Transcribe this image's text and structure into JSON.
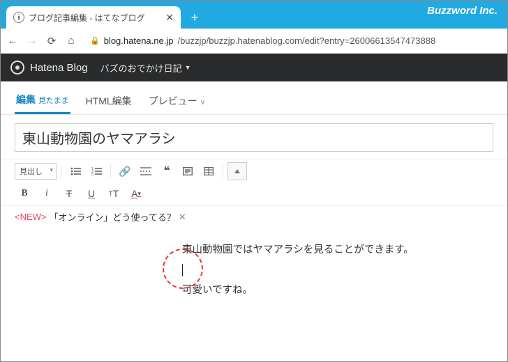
{
  "brand": "Buzzword Inc.",
  "browser_tab": {
    "title": "ブログ記事編集 - はてなブログ"
  },
  "url": {
    "host": "blog.hatena.ne.jp",
    "path": "/buzzjp/buzzjp.hatenablog.com/edit?entry=26006613547473888"
  },
  "blog": {
    "service": "Hatena Blog",
    "name": "バズのおでかけ日記"
  },
  "editor_tabs": {
    "edit": "編集",
    "edit_sub": "見たまま",
    "html": "HTML編集",
    "preview": "プレビュー"
  },
  "post_title": "東山動物園のヤマアラシ",
  "toolbar": {
    "heading_label": "見出し"
  },
  "promo": {
    "tag": "<NEW>",
    "text": "「オンライン」どう使ってる？",
    "close": "✕"
  },
  "body": {
    "line1": "東山動物園ではヤマアラシを見ることができます。",
    "line3": "可愛いですね。"
  }
}
